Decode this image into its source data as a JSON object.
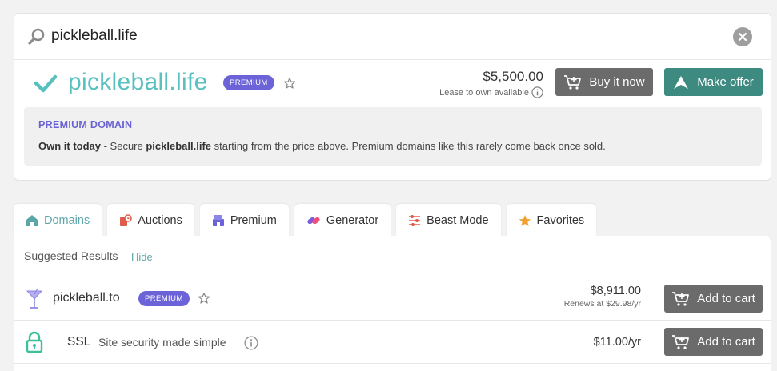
{
  "search": {
    "query": "pickleball.life"
  },
  "result": {
    "domain": "pickleball.life",
    "badge": "PREMIUM",
    "price": "$5,500.00",
    "lease_text": "Lease to own available",
    "buy_label": "Buy it now",
    "offer_label": "Make offer"
  },
  "premium_info": {
    "heading": "PREMIUM DOMAIN",
    "lead": "Own it today",
    "text_before": " - Secure ",
    "domain": "pickleball.life",
    "text_after": " starting from the price above. Premium domains like this rarely come back once sold."
  },
  "tabs": [
    {
      "label": "Domains",
      "icon": "home-icon",
      "active": true
    },
    {
      "label": "Auctions",
      "icon": "auction-icon"
    },
    {
      "label": "Premium",
      "icon": "premium-icon"
    },
    {
      "label": "Generator",
      "icon": "generator-icon"
    },
    {
      "label": "Beast Mode",
      "icon": "sliders-icon"
    },
    {
      "label": "Favorites",
      "icon": "star-icon"
    }
  ],
  "suggested": {
    "label": "Suggested Results",
    "hide_label": "Hide",
    "items": [
      {
        "domain": "pickleball.to",
        "badge": "PREMIUM",
        "price": "$8,911.00",
        "renewal": "Renews at $29.98/yr",
        "button": "Add to cart",
        "icon": "cocktail-icon"
      },
      {
        "title": "SSL",
        "description": "Site security made simple",
        "price": "$11.00/yr",
        "button": "Add to cart",
        "icon": "lock-icon"
      }
    ]
  },
  "colors": {
    "teal": "#59c0c0",
    "premium_purple": "#6c63d9",
    "button_gray": "#6b6b6b",
    "offer_green": "#3d8a80"
  }
}
